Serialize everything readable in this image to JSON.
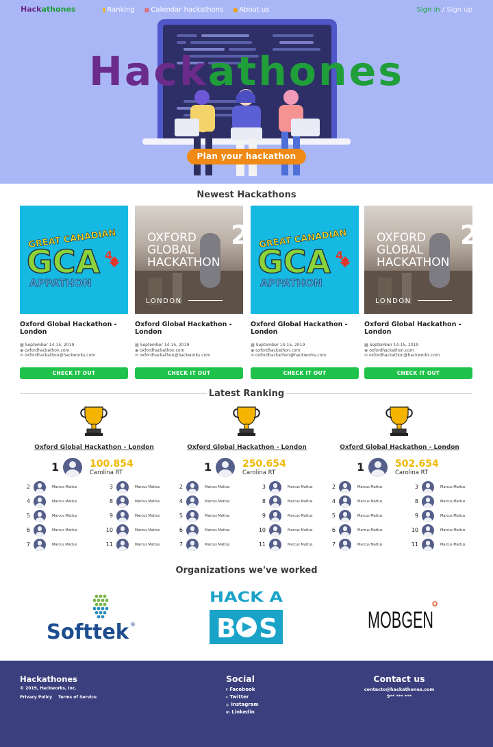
{
  "nav": {
    "brand_part1": "Hack",
    "brand_part2": "athones",
    "links": [
      {
        "icon": "ranking-icon",
        "label": "Ranking"
      },
      {
        "icon": "calendar-icon",
        "label": "Calendar hackathons"
      },
      {
        "icon": "info-icon",
        "label": "About us"
      }
    ],
    "sign_in": "Sign in",
    "separator": "/",
    "sign_up": "Sign up"
  },
  "hero": {
    "title_part1": "Hack",
    "title_part2": "athones",
    "cta": "Plan your hackathon"
  },
  "newest": {
    "heading": "Newest Hackathons",
    "cards": [
      {
        "image": "gca",
        "title": "Oxford Global Hackathon - London",
        "date": "September 14-15, 2019",
        "site": "oxfordhackathon.com",
        "email": "oxfordhackathon@hackworks.com",
        "button": "CHECK IT OUT"
      },
      {
        "image": "oxford",
        "title": "Oxford Global Hackathon - London",
        "date": "September 14-15, 2019",
        "site": "oxfordhackathon.com",
        "email": "oxfordhackathon@hackworks.com",
        "button": "CHECK IT OUT"
      },
      {
        "image": "gca",
        "title": "Oxford Global Hackathon - London",
        "date": "September 14-15, 2019",
        "site": "oxfordhackathon.com",
        "email": "oxfordhackathon@hackworks.com",
        "button": "CHECK IT OUT"
      },
      {
        "image": "oxford",
        "title": "Oxford Global Hackathon - London",
        "date": "September 14-15, 2019",
        "site": "oxfordhackathon.com",
        "email": "oxfordhackathon@hackworks.com",
        "button": "CHECK IT OUT"
      }
    ],
    "gca_text": {
      "line1": "GREAT CANADIAN",
      "mid": "GCA",
      "sup": "4",
      "line3": "APPATHON"
    },
    "oxford_text": {
      "line1": "OXFORD",
      "line2": "GLOBAL",
      "line3": "HACKATHON",
      "num": "2",
      "city": "LONDON"
    }
  },
  "ranking": {
    "heading": "Latest Ranking",
    "columns": [
      {
        "title": "Oxford Global Hackathon - London",
        "first": {
          "rank": "1",
          "score": "100.854",
          "name": "Carolina RT"
        },
        "left": [
          {
            "rank": "2",
            "name": "Marcus Mattus"
          },
          {
            "rank": "4",
            "name": "Marcus Mattus"
          },
          {
            "rank": "5",
            "name": "Marcus Mattus"
          },
          {
            "rank": "6",
            "name": "Marcus Mattus"
          },
          {
            "rank": "7",
            "name": "Marcus Mattus"
          }
        ],
        "right": [
          {
            "rank": "3",
            "name": "Marcus Mattus"
          },
          {
            "rank": "8",
            "name": "Marcus Mattus"
          },
          {
            "rank": "9",
            "name": "Marcus Mattus"
          },
          {
            "rank": "10",
            "name": "Marcus Mattus"
          },
          {
            "rank": "11",
            "name": "Marcus Mattus"
          }
        ]
      },
      {
        "title": "Oxford Global Hackathon - London",
        "first": {
          "rank": "1",
          "score": "250.654",
          "name": "Carolina RT"
        },
        "left": [
          {
            "rank": "2",
            "name": "Marcus Mattus"
          },
          {
            "rank": "4",
            "name": "Marcus Mattus"
          },
          {
            "rank": "5",
            "name": "Marcus Mattus"
          },
          {
            "rank": "6",
            "name": "Marcus Mattus"
          },
          {
            "rank": "7",
            "name": "Marcus Mattus"
          }
        ],
        "right": [
          {
            "rank": "3",
            "name": "Marcus Mattus"
          },
          {
            "rank": "8",
            "name": "Marcus Mattus"
          },
          {
            "rank": "9",
            "name": "Marcus Mattus"
          },
          {
            "rank": "10",
            "name": "Marcus Mattus"
          },
          {
            "rank": "11",
            "name": "Marcus Mattus"
          }
        ]
      },
      {
        "title": "Oxford Global Hackathon - London",
        "first": {
          "rank": "1",
          "score": "502.654",
          "name": "Carolina RT"
        },
        "left": [
          {
            "rank": "2",
            "name": "Marcus Mattus"
          },
          {
            "rank": "4",
            "name": "Marcus Mattus"
          },
          {
            "rank": "5",
            "name": "Marcus Mattus"
          },
          {
            "rank": "6",
            "name": "Marcus Mattus"
          },
          {
            "rank": "7",
            "name": "Marcus Mattus"
          }
        ],
        "right": [
          {
            "rank": "3",
            "name": "Marcus Mattus"
          },
          {
            "rank": "8",
            "name": "Marcus Mattus"
          },
          {
            "rank": "9",
            "name": "Marcus Mattus"
          },
          {
            "rank": "10",
            "name": "Marcus Mattus"
          },
          {
            "rank": "11",
            "name": "Marcus Mattus"
          }
        ]
      }
    ]
  },
  "orgs": {
    "heading": "Organizations we've worked",
    "softtek": "Softtek",
    "hackabos_top": "HACK A",
    "hackabos_bottom_left": "B",
    "hackabos_bottom_right": "S",
    "mobgen": "MOBGEN"
  },
  "footer": {
    "brand": "Hackathones",
    "copyright": "© 2019, Hackworks, Inc.",
    "privacy": "Privacy Policy",
    "terms": "Terms of Service",
    "social_heading": "Social",
    "social": [
      "Facebook",
      "Twitter",
      "Instagram",
      "Linkedin"
    ],
    "contact_heading": "Contact us",
    "email": "contacto@hackathones.com",
    "phone": "9** *** ***"
  },
  "colors": {
    "hero_bg": "#aab7f7",
    "brand_purple": "#6a2b8a",
    "brand_green": "#1f9e3a",
    "cta_orange": "#f08a16",
    "button_green": "#1fc24a",
    "score_gold": "#f0b800",
    "footer_bg": "#3b3f7d"
  }
}
